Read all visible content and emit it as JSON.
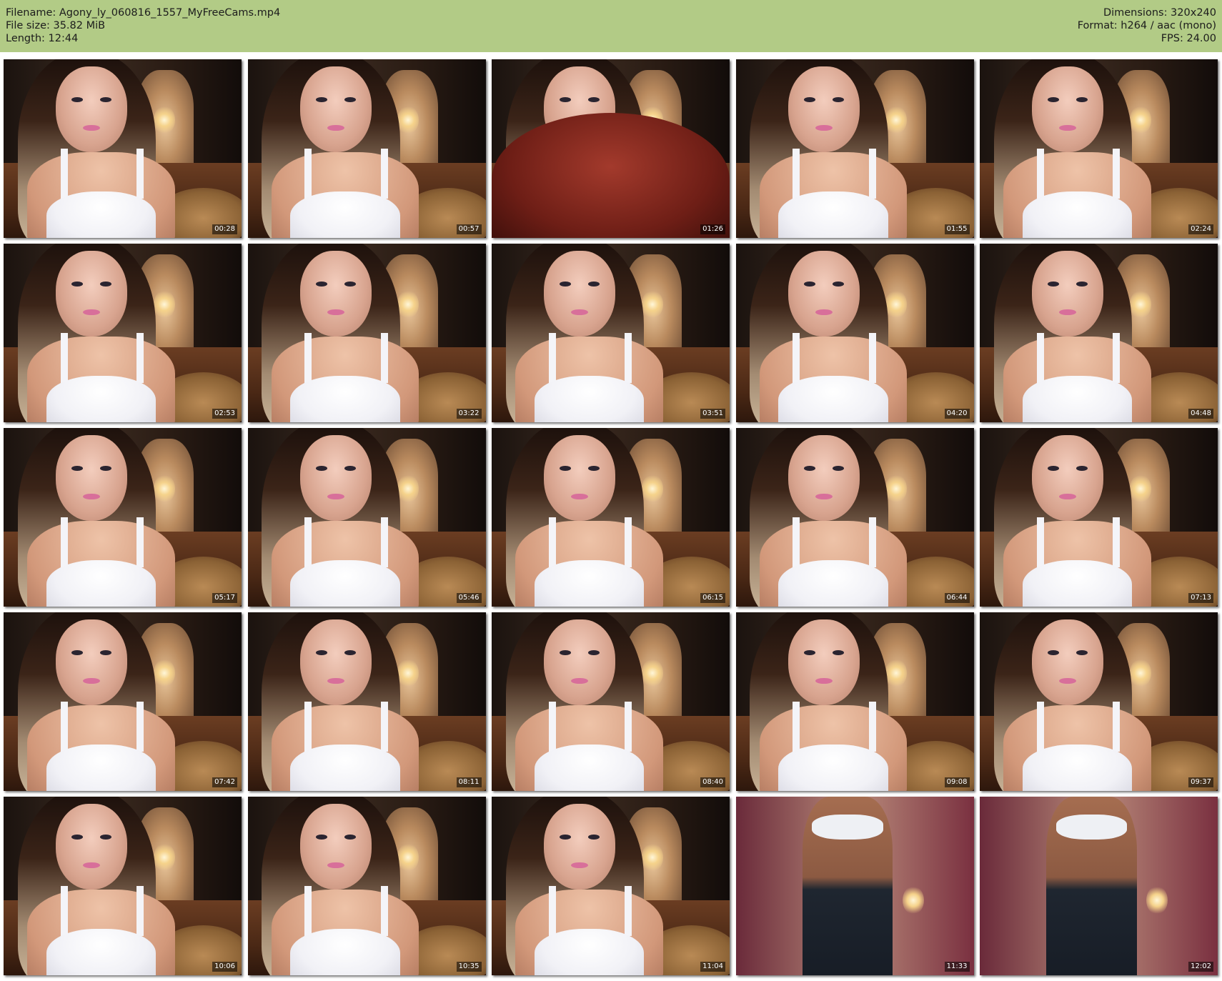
{
  "header": {
    "filename_label": "Filename: Agony_ly_060816_1557_MyFreeCams.mp4",
    "filesize_label": "File size: 35.82 MiB",
    "length_label": "Length: 12:44",
    "dimensions_label": "Dimensions: 320x240",
    "format_label": "Format: h264 / aac (mono)",
    "fps_label": "FPS: 24.00",
    "background_color": "#b2cb86"
  },
  "thumbnails": [
    {
      "time": "00:28",
      "variant": "face"
    },
    {
      "time": "00:57",
      "variant": "face"
    },
    {
      "time": "01:26",
      "variant": "hand"
    },
    {
      "time": "01:55",
      "variant": "face"
    },
    {
      "time": "02:24",
      "variant": "face"
    },
    {
      "time": "02:53",
      "variant": "face"
    },
    {
      "time": "03:22",
      "variant": "face"
    },
    {
      "time": "03:51",
      "variant": "face"
    },
    {
      "time": "04:20",
      "variant": "face"
    },
    {
      "time": "04:48",
      "variant": "face"
    },
    {
      "time": "05:17",
      "variant": "face"
    },
    {
      "time": "05:46",
      "variant": "face"
    },
    {
      "time": "06:15",
      "variant": "face"
    },
    {
      "time": "06:44",
      "variant": "face"
    },
    {
      "time": "07:13",
      "variant": "face"
    },
    {
      "time": "07:42",
      "variant": "face"
    },
    {
      "time": "08:11",
      "variant": "face"
    },
    {
      "time": "08:40",
      "variant": "face"
    },
    {
      "time": "09:08",
      "variant": "face"
    },
    {
      "time": "09:37",
      "variant": "face"
    },
    {
      "time": "10:06",
      "variant": "face"
    },
    {
      "time": "10:35",
      "variant": "face"
    },
    {
      "time": "11:04",
      "variant": "face"
    },
    {
      "time": "11:33",
      "variant": "body"
    },
    {
      "time": "12:02",
      "variant": "body"
    }
  ]
}
